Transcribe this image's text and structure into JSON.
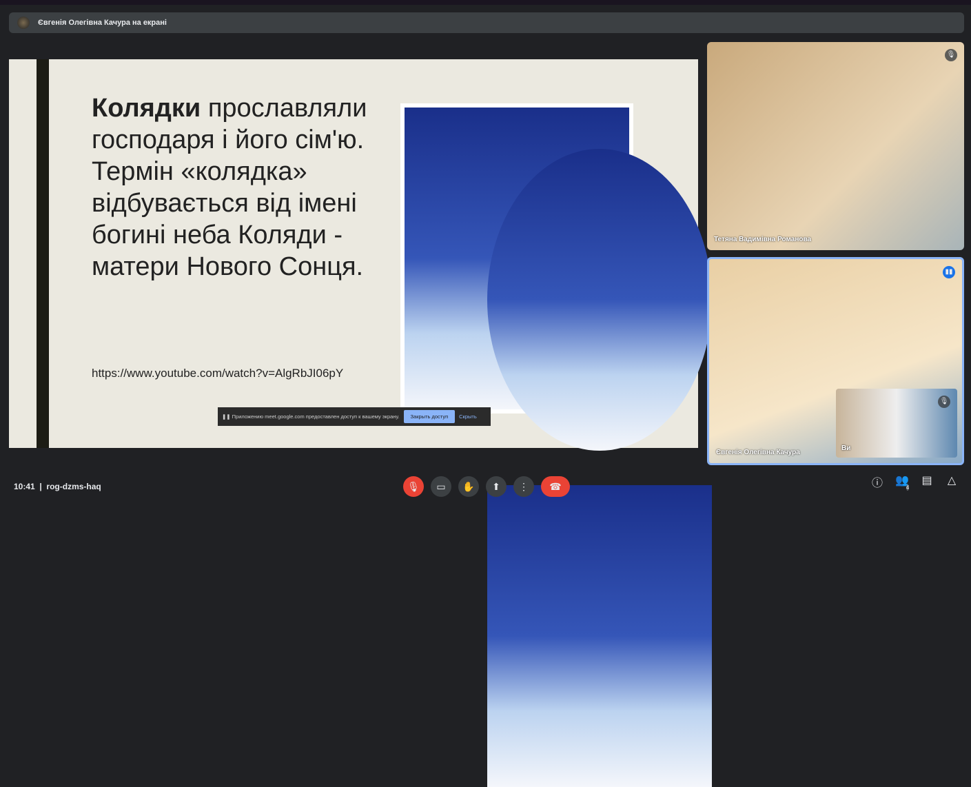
{
  "banner": {
    "text": "Євгенія Олегівна Качура на екрані"
  },
  "slide": {
    "title_bold": "Колядки",
    "title_rest": " прославляли господаря і його сім'ю. Термін «колядка» відбувається від імені богині неба Коляди - матери Нового Сонця.",
    "url": "https://www.youtube.com/watch?v=AlgRbJI06pY"
  },
  "infobar": {
    "text": "Приложению meet.google.com предоставлен доступ к вашему экрану.",
    "close": "Закрыть доступ",
    "hide": "Скрыть"
  },
  "participants": [
    {
      "name": "Тетяна Вадимівна Романова"
    },
    {
      "name": "Євгенія Олегівна Качура"
    },
    {
      "name": "Ви"
    }
  ],
  "bottom": {
    "time": "10:41",
    "separator": "|",
    "code": "rog-dzms-haq",
    "people_count": "4"
  }
}
